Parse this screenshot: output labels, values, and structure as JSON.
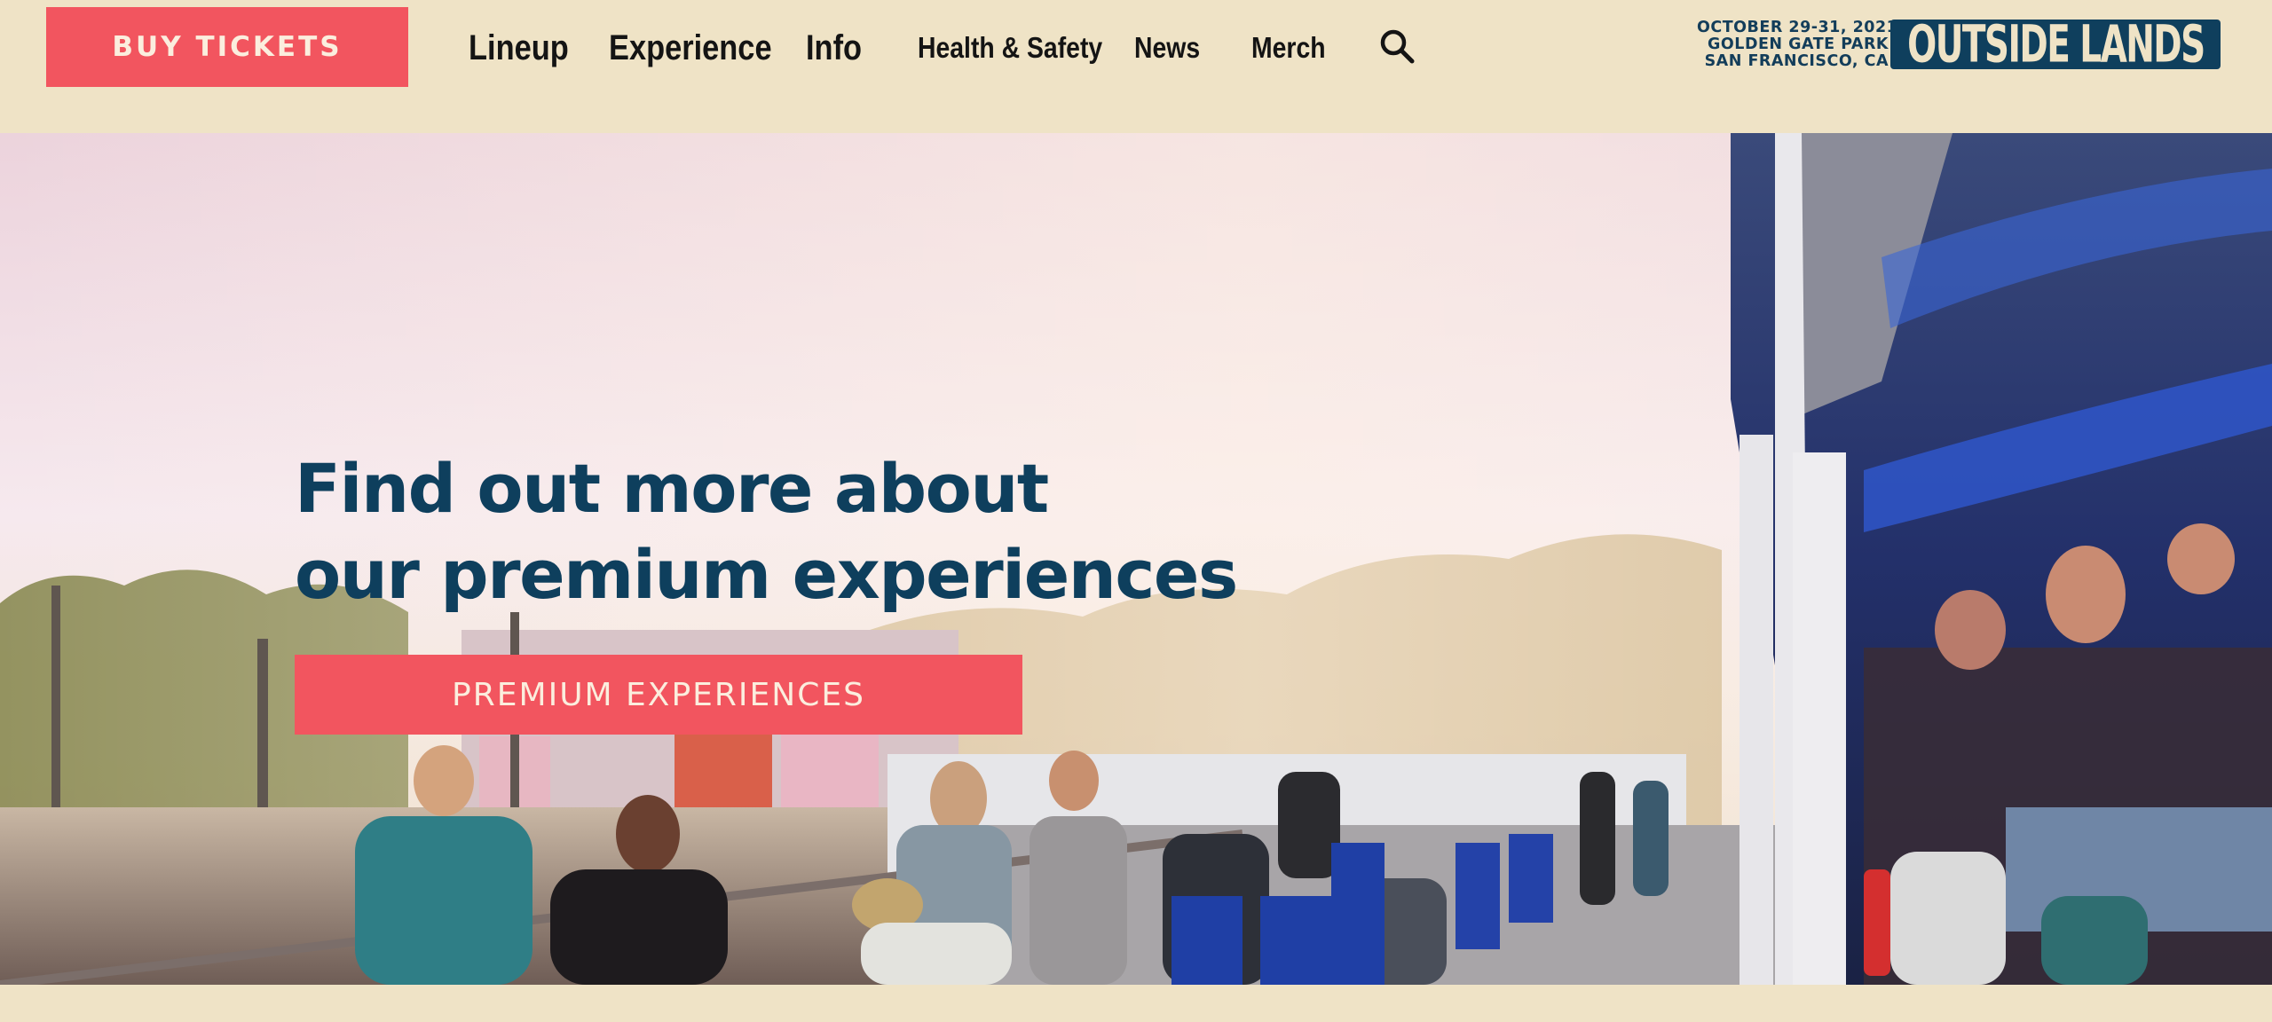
{
  "header": {
    "buy_tickets_label": "BUY TICKETS",
    "nav": [
      {
        "label": "Lineup"
      },
      {
        "label": "Experience"
      },
      {
        "label": "Info"
      },
      {
        "label": "Health & Safety"
      },
      {
        "label": "News"
      },
      {
        "label": "Merch"
      }
    ],
    "search_icon": "search-icon",
    "festival_info": {
      "dates": "OCTOBER 29-31, 2021",
      "venue": "GOLDEN GATE PARK",
      "city": "SAN FRANCISCO, CA"
    },
    "logo_text": "OUTSIDE LANDS"
  },
  "hero": {
    "headline_line1": "Find out more about",
    "headline_line2": "our premium experiences",
    "cta_label": "PREMIUM EXPERIENCES"
  },
  "colors": {
    "accent": "#f2555f",
    "brand_navy": "#0e3f5d",
    "background": "#efe3c6"
  }
}
